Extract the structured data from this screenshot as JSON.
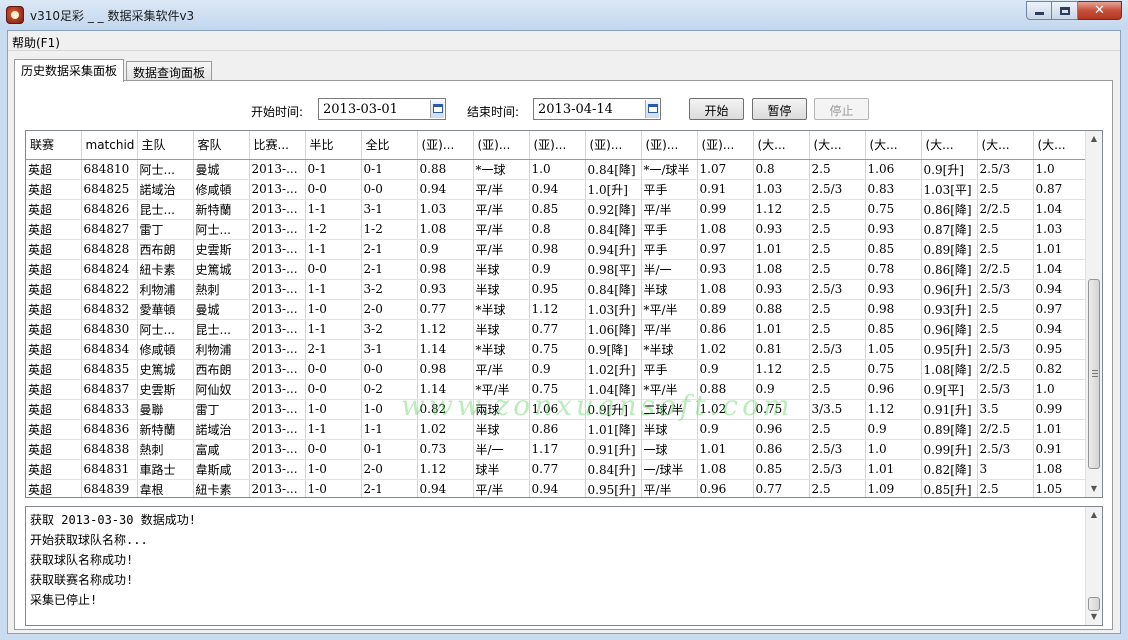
{
  "window": {
    "title": "v310足彩 _ _ 数据采集软件v3",
    "close_glyph": "✕"
  },
  "menu": {
    "help": "帮助(F1)"
  },
  "tabs": [
    {
      "label": "历史数据采集面板"
    },
    {
      "label": "数据查询面板"
    }
  ],
  "controls": {
    "start_label": "开始时间:",
    "start_date": "2013-03-01",
    "end_label": "结束时间:",
    "end_date": "2013-04-14",
    "start_button": "开始",
    "pause_button": "暂停",
    "stop_button": "停止"
  },
  "table": {
    "columns": [
      "联赛",
      "matchid",
      "主队",
      "客队",
      "比赛...",
      "半比",
      "全比",
      "(亚)...",
      "(亚)...",
      "(亚)...",
      "(亚)...",
      "(亚)...",
      "(亚)...",
      "(大...",
      "(大...",
      "(大...",
      "(大...",
      "(大...",
      "(大..."
    ],
    "rows": [
      [
        "英超",
        "684810",
        "阿士...",
        "曼城",
        "2013-...",
        "0-1",
        "0-1",
        "0.88",
        "*一球",
        "1.0",
        "0.84[降]",
        "*一/球半",
        "1.07",
        "0.8",
        "2.5",
        "1.06",
        "0.9[升]",
        "2.5/3",
        "1.0"
      ],
      [
        "英超",
        "684825",
        "諾域治",
        "修咸頓",
        "2013-...",
        "0-0",
        "0-0",
        "0.94",
        "平/半",
        "0.94",
        "1.0[升]",
        "平手",
        "0.91",
        "1.03",
        "2.5/3",
        "0.83",
        "1.03[平]",
        "2.5",
        "0.87"
      ],
      [
        "英超",
        "684826",
        "昆士...",
        "新特蘭",
        "2013-...",
        "1-1",
        "3-1",
        "1.03",
        "平/半",
        "0.85",
        "0.92[降]",
        "平/半",
        "0.99",
        "1.12",
        "2.5",
        "0.75",
        "0.86[降]",
        "2/2.5",
        "1.04"
      ],
      [
        "英超",
        "684827",
        "雷丁",
        "阿士...",
        "2013-...",
        "1-2",
        "1-2",
        "1.08",
        "平/半",
        "0.8",
        "0.84[降]",
        "平手",
        "1.08",
        "0.93",
        "2.5",
        "0.93",
        "0.87[降]",
        "2.5",
        "1.03"
      ],
      [
        "英超",
        "684828",
        "西布朗",
        "史雲斯",
        "2013-...",
        "1-1",
        "2-1",
        "0.9",
        "平/半",
        "0.98",
        "0.94[升]",
        "平手",
        "0.97",
        "1.01",
        "2.5",
        "0.85",
        "0.89[降]",
        "2.5",
        "1.01"
      ],
      [
        "英超",
        "684824",
        "紐卡素",
        "史篤城",
        "2013-...",
        "0-0",
        "2-1",
        "0.98",
        "半球",
        "0.9",
        "0.98[平]",
        "半/一",
        "0.93",
        "1.08",
        "2.5",
        "0.78",
        "0.86[降]",
        "2/2.5",
        "1.04"
      ],
      [
        "英超",
        "684822",
        "利物浦",
        "熱刺",
        "2013-...",
        "1-1",
        "3-2",
        "0.93",
        "半球",
        "0.95",
        "0.84[降]",
        "半球",
        "1.08",
        "0.93",
        "2.5/3",
        "0.93",
        "0.96[升]",
        "2.5/3",
        "0.94"
      ],
      [
        "英超",
        "684832",
        "愛華頓",
        "曼城",
        "2013-...",
        "1-0",
        "2-0",
        "0.77",
        "*半球",
        "1.12",
        "1.03[升]",
        "*平/半",
        "0.89",
        "0.88",
        "2.5",
        "0.98",
        "0.93[升]",
        "2.5",
        "0.97"
      ],
      [
        "英超",
        "684830",
        "阿士...",
        "昆士...",
        "2013-...",
        "1-1",
        "3-2",
        "1.12",
        "半球",
        "0.77",
        "1.06[降]",
        "平/半",
        "0.86",
        "1.01",
        "2.5",
        "0.85",
        "0.96[降]",
        "2.5",
        "0.94"
      ],
      [
        "英超",
        "684834",
        "修咸頓",
        "利物浦",
        "2013-...",
        "2-1",
        "3-1",
        "1.14",
        "*半球",
        "0.75",
        "0.9[降]",
        "*半球",
        "1.02",
        "0.81",
        "2.5/3",
        "1.05",
        "0.95[升]",
        "2.5/3",
        "0.95"
      ],
      [
        "英超",
        "684835",
        "史篤城",
        "西布朗",
        "2013-...",
        "0-0",
        "0-0",
        "0.98",
        "平/半",
        "0.9",
        "1.02[升]",
        "平手",
        "0.9",
        "1.12",
        "2.5",
        "0.75",
        "1.08[降]",
        "2/2.5",
        "0.82"
      ],
      [
        "英超",
        "684837",
        "史雲斯",
        "阿仙奴",
        "2013-...",
        "0-0",
        "0-2",
        "1.14",
        "*平/半",
        "0.75",
        "1.04[降]",
        "*平/半",
        "0.88",
        "0.9",
        "2.5",
        "0.96",
        "0.9[平]",
        "2.5/3",
        "1.0"
      ],
      [
        "英超",
        "684833",
        "曼聯",
        "雷丁",
        "2013-...",
        "1-0",
        "1-0",
        "0.82",
        "兩球",
        "1.06",
        "0.9[升]",
        "二球/半",
        "1.02",
        "0.75",
        "3/3.5",
        "1.12",
        "0.91[升]",
        "3.5",
        "0.99"
      ],
      [
        "英超",
        "684836",
        "新特蘭",
        "諾域治",
        "2013-...",
        "1-1",
        "1-1",
        "1.02",
        "半球",
        "0.86",
        "1.01[降]",
        "半球",
        "0.9",
        "0.96",
        "2.5",
        "0.9",
        "0.89[降]",
        "2/2.5",
        "1.01"
      ],
      [
        "英超",
        "684838",
        "熱刺",
        "富咸",
        "2013-...",
        "0-0",
        "0-1",
        "0.73",
        "半/一",
        "1.17",
        "0.91[升]",
        "一球",
        "1.01",
        "0.86",
        "2.5/3",
        "1.0",
        "0.99[升]",
        "2.5/3",
        "0.91"
      ],
      [
        "英超",
        "684831",
        "車路士",
        "韋斯咸",
        "2013-...",
        "1-0",
        "2-0",
        "1.12",
        "球半",
        "0.77",
        "0.84[升]",
        "一/球半",
        "1.08",
        "0.85",
        "2.5/3",
        "1.01",
        "0.82[降]",
        "3",
        "1.08"
      ],
      [
        "英超",
        "684839",
        "韋根",
        "紐卡素",
        "2013-...",
        "1-0",
        "2-1",
        "0.94",
        "平/半",
        "0.94",
        "0.95[升]",
        "平/半",
        "0.96",
        "0.77",
        "2.5",
        "1.09",
        "0.85[升]",
        "2.5",
        "1.05"
      ]
    ]
  },
  "watermark": "www.zonxuansoft.com",
  "log": [
    "获取 2013-03-30 数据成功!",
    "开始获取球队名称...",
    "获取球队名称成功!",
    "获取联赛名称成功!",
    "采集已停止!"
  ],
  "icons": {
    "app": "app-icon",
    "calendar": "calendar-icon",
    "scroll_up": "▲",
    "scroll_down": "▼"
  }
}
